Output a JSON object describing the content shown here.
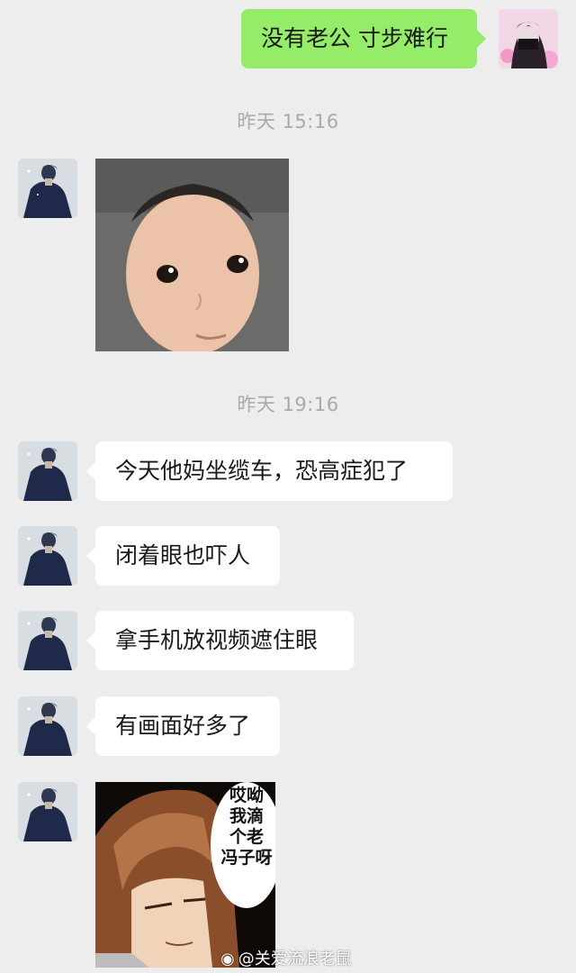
{
  "messages": {
    "m1": {
      "sender": "self",
      "text": "没有老公 寸步难行"
    },
    "t1": {
      "text": "昨天 15:16"
    },
    "m2": {
      "sender": "other",
      "type": "image",
      "alt": "baby-face-sticker"
    },
    "t2": {
      "text": "昨天 19:16"
    },
    "m3": {
      "sender": "other",
      "text": "今天他妈坐缆车，恐高症犯了"
    },
    "m4": {
      "sender": "other",
      "text": "闭着眼也吓人"
    },
    "m5": {
      "sender": "other",
      "text": "拿手机放视频遮住眼"
    },
    "m6": {
      "sender": "other",
      "text": "有画面好多了"
    },
    "m7": {
      "sender": "other",
      "type": "image",
      "alt": "manga-sticker",
      "caption_lines": [
        "哎呦",
        "我滴",
        "个老",
        "冯子呀"
      ]
    }
  },
  "watermark": {
    "icon": "weibo-icon",
    "text": "@关爱流浪老鼠"
  },
  "colors": {
    "background": "#ededed",
    "self_bubble": "#95ec69",
    "other_bubble": "#ffffff",
    "timestamp": "#a9a9a9"
  }
}
